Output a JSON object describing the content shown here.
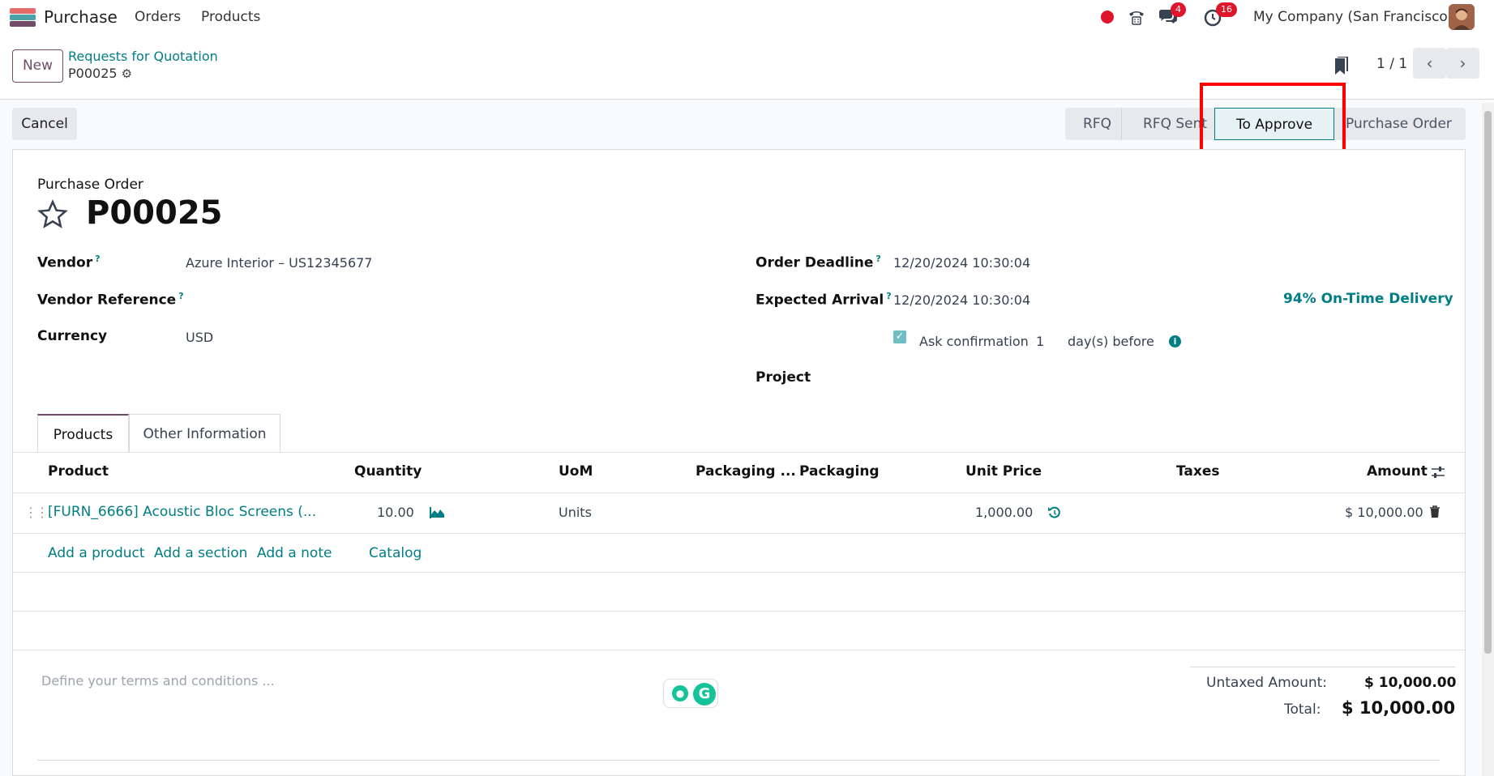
{
  "topbar": {
    "app_name": "Purchase",
    "menu": [
      "Orders",
      "Products"
    ],
    "messages_count": "4",
    "activities_count": "16",
    "company": "My Company (San Francisco)"
  },
  "control_panel": {
    "new_label": "New",
    "breadcrumb_parent": "Requests for Quotation",
    "breadcrumb_current": "P00025",
    "pager": "1 / 1"
  },
  "status": {
    "cancel_label": "Cancel",
    "stages": [
      "RFQ",
      "RFQ Sent",
      "To Approve",
      "Purchase Order"
    ],
    "active_stage": "To Approve"
  },
  "form": {
    "doc_type": "Purchase Order",
    "doc_number": "P00025",
    "vendor_label": "Vendor",
    "vendor_value": "Azure Interior – US12345677",
    "vendor_ref_label": "Vendor Reference",
    "currency_label": "Currency",
    "currency_value": "USD",
    "deadline_label": "Order Deadline",
    "deadline_value": "12/20/2024 10:30:04",
    "arrival_label": "Expected Arrival",
    "arrival_value": "12/20/2024 10:30:04",
    "on_time": "94% On-Time Delivery",
    "ask_confirmation_label": "Ask confirmation",
    "ask_confirmation_days": "1",
    "days_before": "day(s) before",
    "project_label": "Project",
    "help_mark": "?"
  },
  "tabs": [
    "Products",
    "Other Information"
  ],
  "table": {
    "headers": [
      "Product",
      "Quantity",
      "UoM",
      "Packaging ...",
      "Packaging",
      "Unit Price",
      "Taxes",
      "Amount"
    ],
    "rows": [
      {
        "product": "[FURN_6666] Acoustic Bloc Screens (...",
        "quantity": "10.00",
        "uom": "Units",
        "unit_price": "1,000.00",
        "amount": "$ 10,000.00"
      }
    ],
    "actions": [
      "Add a product",
      "Add a section",
      "Add a note",
      "Catalog"
    ]
  },
  "footer": {
    "terms_placeholder": "Define your terms and conditions ...",
    "untaxed_label": "Untaxed Amount:",
    "untaxed_value": "$ 10,000.00",
    "total_label": "Total:",
    "total_value": "$ 10,000.00"
  },
  "colors": {
    "brand": "#714b67",
    "link": "#017e84",
    "highlight": "#ff0000",
    "badge": "#e0142a"
  }
}
